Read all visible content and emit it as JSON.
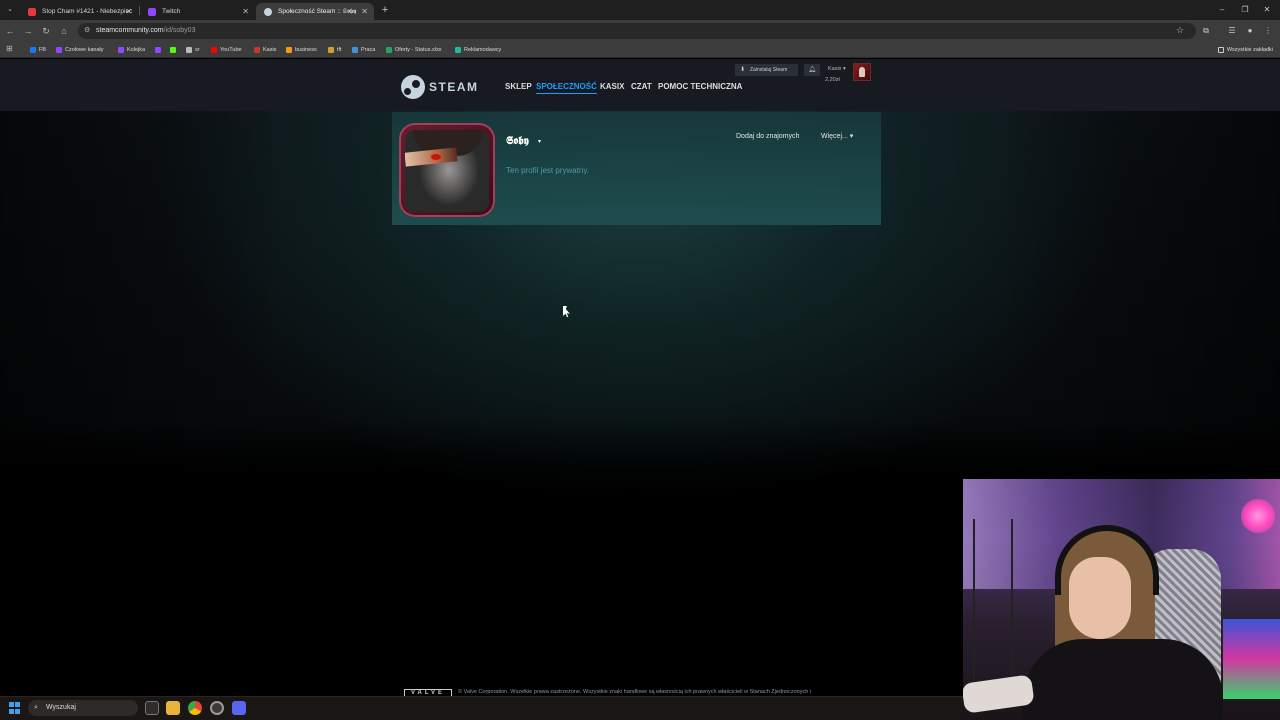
{
  "browser": {
    "tabs": [
      {
        "title": "Stop Cham #1421 - Niebezpiec",
        "favicon_color": "#e53935"
      },
      {
        "title": "Twitch",
        "favicon_color": "#9146ff"
      },
      {
        "title": "Społeczność Steam :: 𝕾𝖔𝖇𝖞",
        "favicon_color": "#c6d4df"
      }
    ],
    "url_host": "steamcommunity.com",
    "url_path": "/id/soby03",
    "bookmarks": [
      {
        "label": "FB",
        "color": "#1877f2"
      },
      {
        "label": "Czołowe kanały",
        "color": "#9146ff"
      },
      {
        "label": "Kolejka",
        "color": "#9146ff"
      },
      {
        "label": "",
        "color": "#9146ff"
      },
      {
        "label": "",
        "color": "#53fc18"
      },
      {
        "label": "sr",
        "color": "#bbbbbb"
      },
      {
        "label": "YouTube",
        "color": "#ff0000"
      },
      {
        "label": "Kasix",
        "color": "#c0392b"
      },
      {
        "label": "business",
        "color": "#f39c12"
      },
      {
        "label": "tft",
        "color": "#c9a227"
      },
      {
        "label": "Praca",
        "color": "#4a90d9"
      },
      {
        "label": "Oferty - Status.xlsx",
        "color": "#21a366"
      },
      {
        "label": "Reklamodawcy",
        "color": "#1abc9c"
      }
    ],
    "all_bookmarks_label": "Wszystkie zakładki"
  },
  "steam": {
    "wordmark": "STEAM",
    "nav": [
      "SKLEP",
      "SPOŁECZNOŚĆ",
      "KASIX",
      "CZAT",
      "POMOC TECHNICZNA"
    ],
    "nav_active_index": 1,
    "install_label": "Zainstaluj Steam",
    "account_name": "Kasix ▾",
    "account_balance": "2,20zł",
    "accent_color": "#1a9fff"
  },
  "profile": {
    "persona_name": "𝕾𝖔𝖇𝖞",
    "private_message": "Ten profil jest prywatny.",
    "add_friend_label": "Dodaj do znajomych",
    "more_label": "Więcej... ▾"
  },
  "footer": {
    "valve_logo": "VALVE",
    "copyright": "© Valve Corporation. Wszelkie prawa zastrzeżone. Wszystkie znaki handlowe są własnością ich prawnych właścicieli w Stanach Zjednoczonych i"
  },
  "taskbar": {
    "search_label": "Wyszukaj"
  }
}
